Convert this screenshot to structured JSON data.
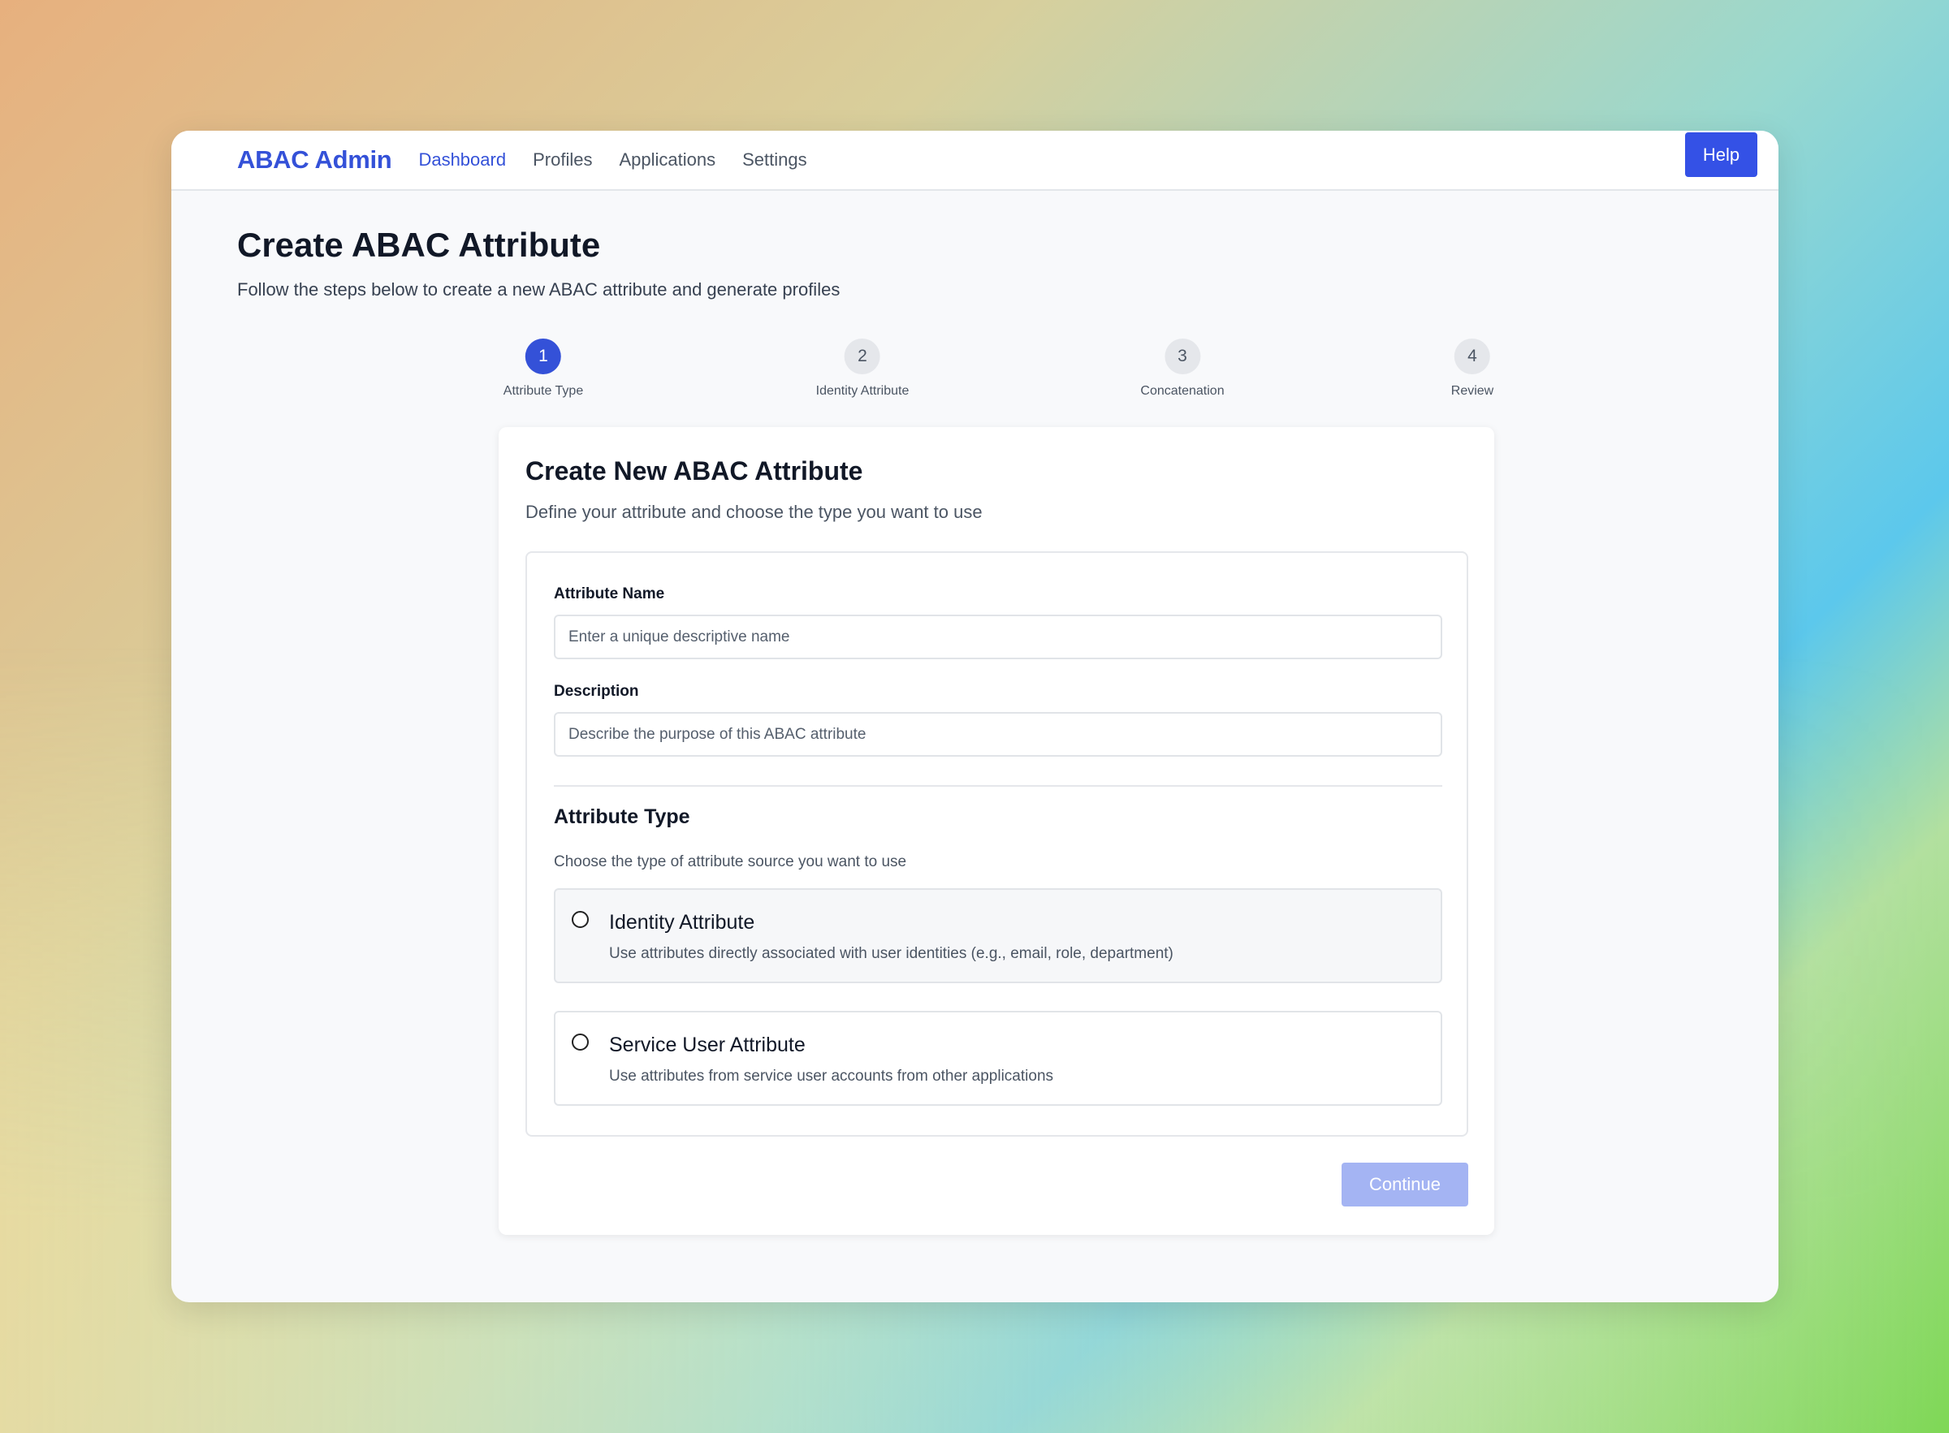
{
  "navbar": {
    "brand": "ABAC Admin",
    "links": [
      {
        "label": "Dashboard",
        "active": true
      },
      {
        "label": "Profiles",
        "active": false
      },
      {
        "label": "Applications",
        "active": false
      },
      {
        "label": "Settings",
        "active": false
      }
    ],
    "help_label": "Help"
  },
  "page": {
    "title": "Create ABAC Attribute",
    "subtitle": "Follow the steps below to create a new ABAC attribute and generate profiles"
  },
  "steps": [
    {
      "number": "1",
      "label": "Attribute Type",
      "active": true
    },
    {
      "number": "2",
      "label": "Identity Attribute",
      "active": false
    },
    {
      "number": "3",
      "label": "Concatenation",
      "active": false
    },
    {
      "number": "4",
      "label": "Review",
      "active": false
    }
  ],
  "card": {
    "title": "Create New ABAC Attribute",
    "subtitle": "Define your attribute and choose the type you want to use",
    "name_label": "Attribute Name",
    "name_value": "",
    "name_placeholder": "Enter a unique descriptive name",
    "description_label": "Description",
    "description_value": "",
    "description_placeholder": "Describe the purpose of this ABAC attribute",
    "type_title": "Attribute Type",
    "type_subtitle": "Choose the type of attribute source you want to use",
    "options": [
      {
        "title": "Identity Attribute",
        "description": "Use attributes directly associated with user identities (e.g., email, role, department)",
        "selected": false
      },
      {
        "title": "Service User Attribute",
        "description": "Use attributes from service user accounts from other applications",
        "selected": false
      }
    ],
    "continue_label": "Continue"
  },
  "colors": {
    "accent": "#3451d8",
    "help_button": "#3451e6",
    "continue_disabled": "#a4b4f3"
  }
}
